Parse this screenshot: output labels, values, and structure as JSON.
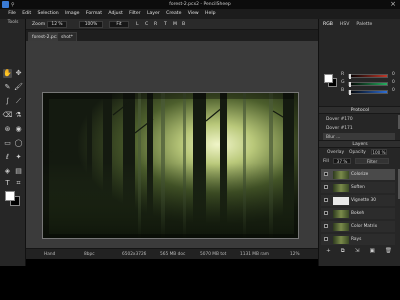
{
  "window": {
    "title": "forest-2.pcx2 - PencilSheep"
  },
  "menu": [
    "File",
    "Edit",
    "Selection",
    "Image",
    "Format",
    "Adjust",
    "Filter",
    "Layer",
    "Create",
    "View",
    "Help"
  ],
  "tools": {
    "header": "Tools"
  },
  "options": {
    "zoom_label": "Zoom",
    "zoom_value": "12 %",
    "zoom_preset": "100%",
    "fit_label": "Fit",
    "buttons": [
      "L",
      "C",
      "R",
      "T",
      "M",
      "B"
    ]
  },
  "tabs": [
    {
      "label": "forest-2.pcx2"
    },
    {
      "label": "shot*"
    }
  ],
  "status": {
    "tool": "Hand",
    "bit_depth": "8bpc",
    "dimensions": "6502x3726",
    "doc_mem": "565 MB doc",
    "total_mem": "5070 MB tot",
    "ram": "1131 MB ram",
    "zoom": "12%"
  },
  "color_panel": {
    "tabs": [
      "RGB",
      "HSV",
      "Palette"
    ],
    "channels": [
      {
        "name": "R",
        "value": "0",
        "color": "#c0392b"
      },
      {
        "name": "G",
        "value": "0",
        "color": "#27ae60"
      },
      {
        "name": "B",
        "value": "0",
        "color": "#2f6fd6"
      }
    ]
  },
  "protocol": {
    "title": "Protocol",
    "items": [
      "Dover #170",
      "Dover #171",
      "Blur ..."
    ]
  },
  "layers": {
    "title": "Layers",
    "overlay_label": "Overlay",
    "opacity_label": "Opacity",
    "opacity_value": "100 %",
    "fill_label": "Fill",
    "fill_value": "37 %",
    "filter_label": "Filter",
    "items": [
      {
        "name": "Colorize",
        "fx": "fx",
        "selected": true
      },
      {
        "name": "Soften",
        "fx": "fx",
        "selected": false
      },
      {
        "name": "Vignette 30",
        "fx": "fx",
        "selected": false,
        "thumb": "white"
      },
      {
        "name": "Bokeh",
        "fx": "fx",
        "selected": false
      },
      {
        "name": "Color Matrix",
        "fx": "fx",
        "selected": false
      },
      {
        "name": "Rays",
        "fx": "fx",
        "selected": false
      }
    ],
    "toolbar_icons": [
      "+",
      "⧉",
      "⇲",
      "▣",
      "🗑"
    ]
  }
}
